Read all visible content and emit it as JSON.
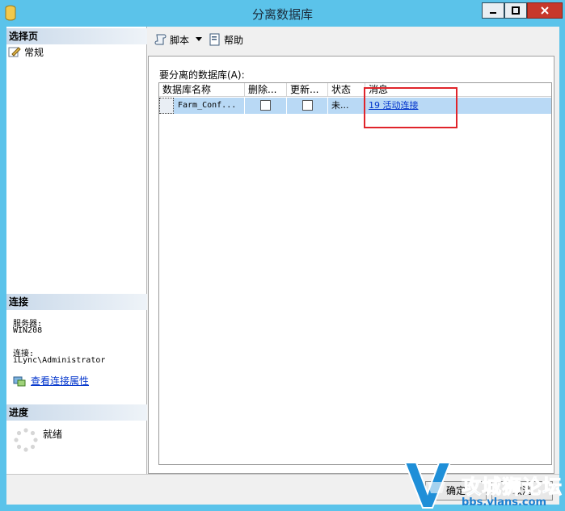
{
  "window": {
    "title": "分离数据库"
  },
  "left": {
    "select_page_header": "选择页",
    "page_general": "常规",
    "connection_header": "连接",
    "server_label": "服务器:",
    "server_value": "WIN208",
    "connection_label": "连接:",
    "connection_value": "iLync\\Administrator",
    "view_props_link": "查看连接属性",
    "progress_header": "进度",
    "progress_status": "就绪"
  },
  "toolbar": {
    "script_label": "脚本",
    "help_label": "帮助"
  },
  "grid": {
    "label": "要分离的数据库(A):",
    "columns": [
      "数据库名称",
      "删除...",
      "更新...",
      "状态",
      "消息"
    ],
    "rows": [
      {
        "name": "Farm_Conf...",
        "drop": false,
        "update": false,
        "status": "未...",
        "message": "19 活动连接"
      }
    ]
  },
  "buttons": {
    "ok": "确定",
    "cancel": "取消"
  },
  "watermark": {
    "brand": "攻城狮论坛",
    "url": "bbs.vlans.com"
  },
  "colors": {
    "title_bar": "#5bc3ea",
    "selection": "#b9d9f5",
    "highlight": "#e0242a",
    "link": "#0033cc"
  }
}
